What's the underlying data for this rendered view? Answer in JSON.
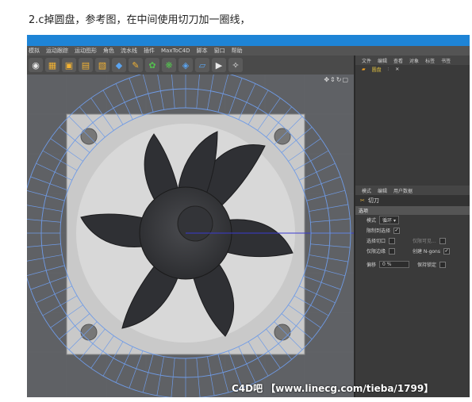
{
  "caption": "2.c掉圆盘，参考图，在中间使用切刀加一圈线，",
  "menubar": [
    "模拟",
    "运动跟踪",
    "运动图形",
    "角色",
    "流水线",
    "插件",
    "MaxToC4D",
    "脚本",
    "窗口",
    "帮助"
  ],
  "object_manager": {
    "menu": [
      "文件",
      "编辑",
      "查看",
      "对象",
      "标签",
      "书签"
    ],
    "object": "圆盘"
  },
  "attribute_manager": {
    "menu": [
      "模式",
      "编辑",
      "用户数据"
    ],
    "tool_name": "切刀",
    "section": "选项",
    "mode_label": "模式",
    "mode_value": "循环",
    "rows": [
      {
        "label": "限制到选择",
        "checked": true
      },
      {
        "label": "选择切口",
        "checked": false,
        "right": "仅限可见...",
        "right_checked": false
      },
      {
        "label": "仅限边缘",
        "checked": false,
        "right": "创建 N-gons",
        "right_checked": true
      }
    ],
    "offset_label": "偏移",
    "offset_value": "0 %",
    "lock_label": "保持锁定"
  },
  "watermark": "C4D吧 【www.linecg.com/tieba/1799】",
  "colors": {
    "accent": "#1e84d6",
    "wire": "#6f9be6"
  }
}
